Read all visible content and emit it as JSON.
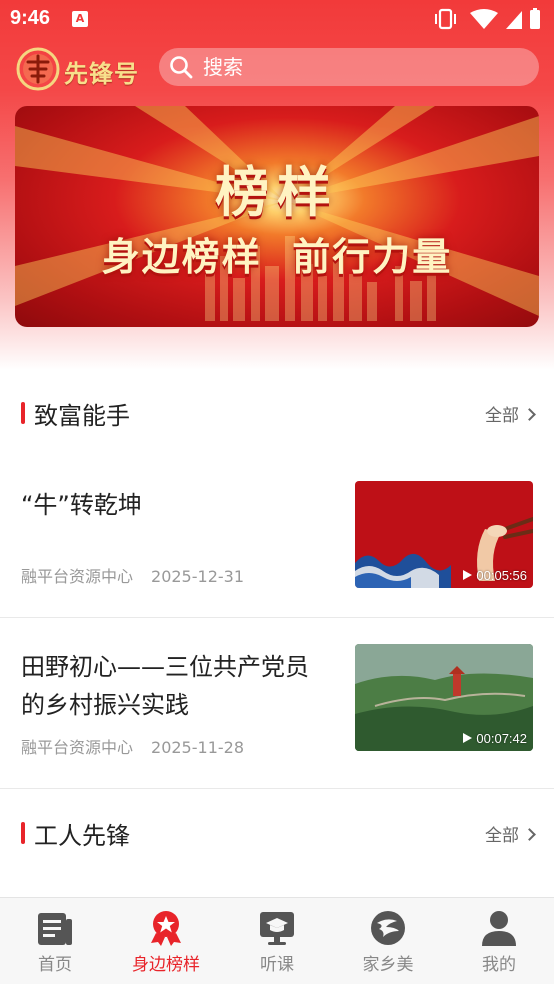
{
  "status_bar": {
    "time": "9:46",
    "app_badge": "A"
  },
  "header": {
    "logo_text": "冀先锋号",
    "search_placeholder": "搜索"
  },
  "banner": {
    "title": "榜样",
    "subtitle": "身边榜样  前行力量"
  },
  "sections": [
    {
      "title": "致富能手",
      "more_label": "全部",
      "articles": [
        {
          "title": "“牛”转乾坤",
          "source": "融平台资源中心",
          "date": "2025-12-31",
          "duration": "00:05:56"
        },
        {
          "title": "田野初心——三位共产党员的乡村振兴实践",
          "source": "融平台资源中心",
          "date": "2025-11-28",
          "duration": "00:07:42"
        }
      ]
    },
    {
      "title": "工人先锋",
      "more_label": "全部"
    }
  ],
  "tabbar": {
    "active_index": 1,
    "tabs": [
      {
        "label": "首页",
        "icon": "news-icon"
      },
      {
        "label": "身边榜样",
        "icon": "star-badge-icon"
      },
      {
        "label": "听课",
        "icon": "monitor-cap-icon"
      },
      {
        "label": "家乡美",
        "icon": "river-icon"
      },
      {
        "label": "我的",
        "icon": "user-icon"
      }
    ]
  },
  "colors": {
    "brand_red": "#e8242a",
    "header_red": "#f23a3a",
    "tab_inactive": "#888888"
  }
}
